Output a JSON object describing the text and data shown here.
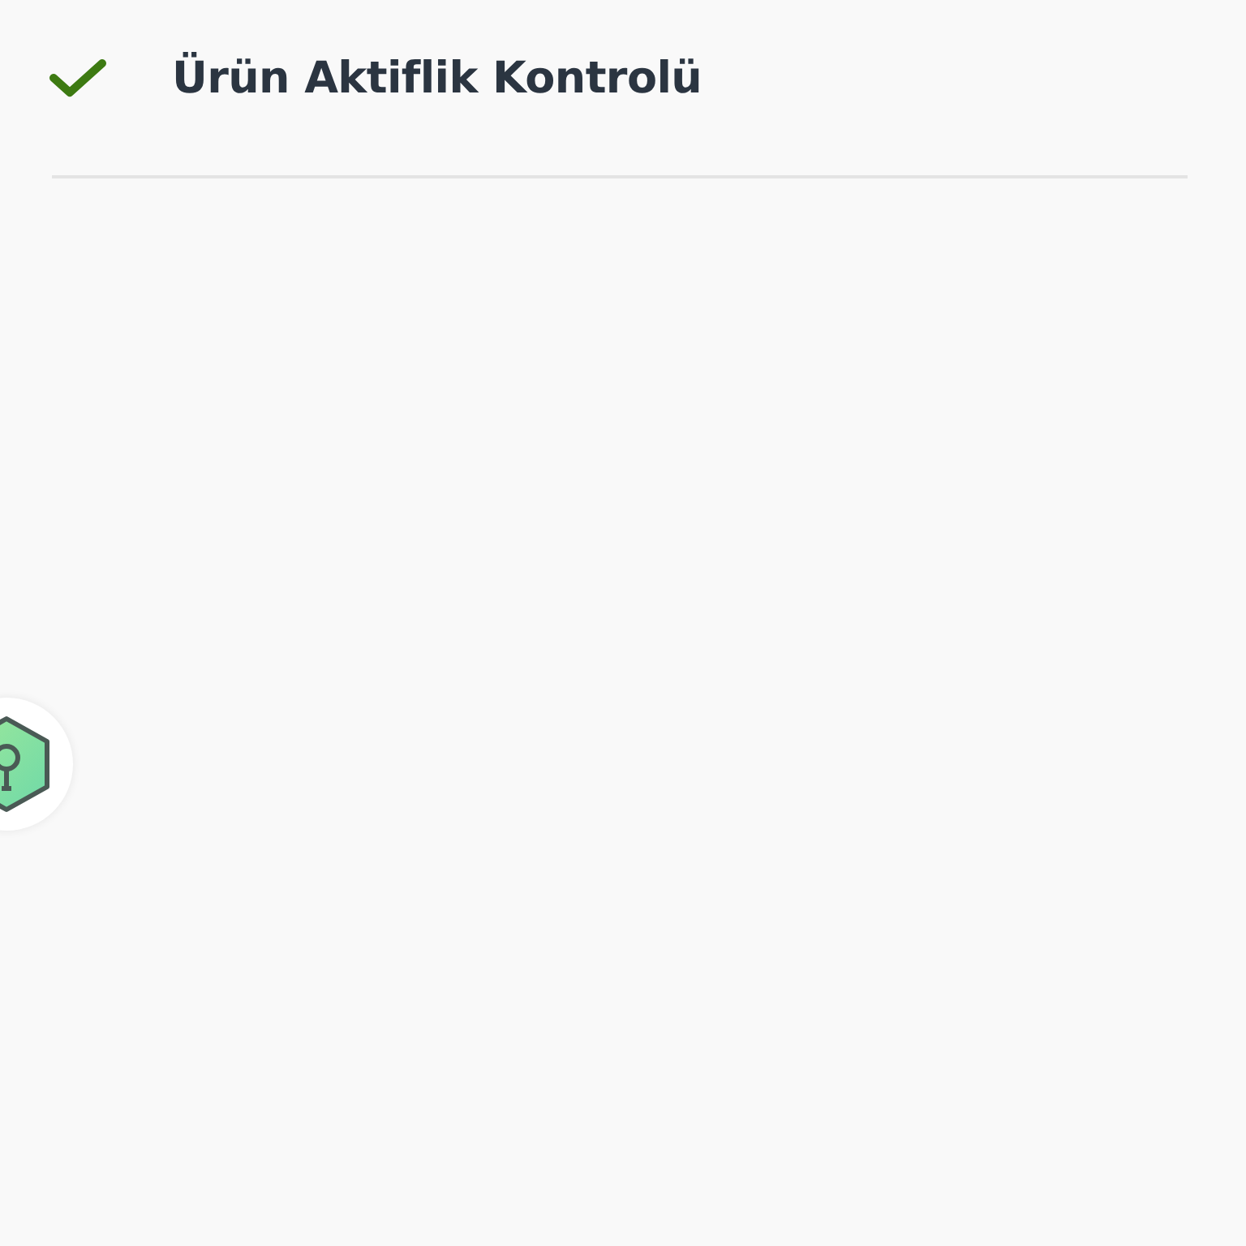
{
  "header": {
    "title": "Ürün Aktiflik Kontrolü",
    "checked": true
  }
}
